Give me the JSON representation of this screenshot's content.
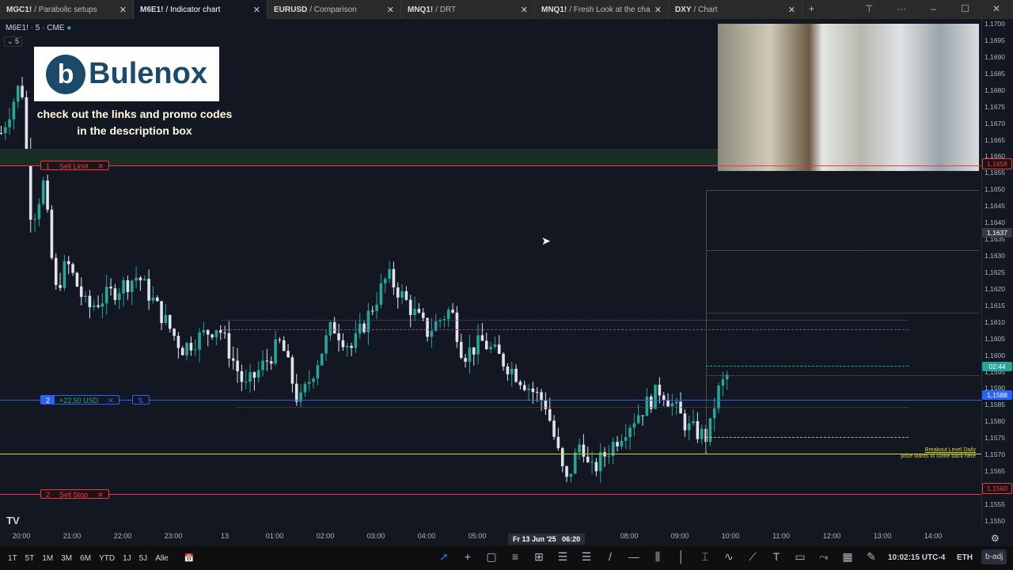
{
  "tabs": [
    {
      "symbol": "MGC1!",
      "name": "Parabolic setups",
      "active": false
    },
    {
      "symbol": "M6E1!",
      "name": "Indicator chart",
      "active": true
    },
    {
      "symbol": "EURUSD",
      "name": "Comparison",
      "active": false
    },
    {
      "symbol": "MNQ1!",
      "name": "DRT",
      "active": false
    },
    {
      "symbol": "MNQ1!",
      "name": "Fresh Look at the cha",
      "active": false
    },
    {
      "symbol": "DXY",
      "name": "Chart",
      "active": false
    }
  ],
  "legend": {
    "title": "M6E1! · 5 · CME",
    "collapse": "5"
  },
  "promo": {
    "brand": "Bulenox",
    "line1": "check out the links and promo codes",
    "line2": "in the description box"
  },
  "orders": {
    "sell_limit": {
      "qty": "1",
      "label": "Sell Limit",
      "close": "✕"
    },
    "position": {
      "qty": "2",
      "pnl": "+22,50 USD",
      "close": "✕",
      "reverse": "⇅"
    },
    "sell_stop": {
      "qty": "2",
      "label": "Sell Stop",
      "close": "✕"
    }
  },
  "annotation": {
    "line1": "Breakout Level Daily",
    "line2": "price wants to come back here"
  },
  "price_axis": {
    "ticks": [
      "1,1700",
      "1,1695",
      "1,1690",
      "1,1685",
      "1,1680",
      "1,1675",
      "1,1670",
      "1,1665",
      "1,1660",
      "1,1655",
      "1,1650",
      "1,1645",
      "1,1640",
      "1,1635",
      "1,1630",
      "1,1625",
      "1,1620",
      "1,1615",
      "1,1610",
      "1,1605",
      "1,1600",
      "1,1595",
      "1,1590",
      "1,1585",
      "1,1580",
      "1,1575",
      "1,1570",
      "1,1565",
      "1,1560",
      "1,1555",
      "1,1550"
    ],
    "labels": {
      "sell_limit": "1,1658",
      "crosshair": "1,1637",
      "countdown": "02:44",
      "position": "1,1588",
      "sell_stop": "1,1560"
    }
  },
  "time_axis": {
    "ticks": [
      "20:00",
      "21:00",
      "22:00",
      "23:00",
      "13",
      "01:00",
      "02:00",
      "03:00",
      "04:00",
      "05:00",
      "08:00",
      "09:00",
      "10:00",
      "11:00",
      "12:00",
      "13:00",
      "14:00"
    ],
    "crosshair": "Fr 13 Jun '25   06:20"
  },
  "ranges": [
    "1T",
    "5T",
    "1M",
    "3M",
    "6M",
    "YTD",
    "1J",
    "5J",
    "Alle"
  ],
  "status": {
    "clock": "10:02:15 UTC-4",
    "session": "ETH",
    "adj": "b-adj"
  },
  "colors": {
    "up": "#26a69a",
    "down": "#e0e3eb",
    "sell": "#f23645",
    "position": "#2962ff",
    "breakout": "#d4d43a"
  },
  "chart_data": {
    "type": "candlestick",
    "interval": "5",
    "ylim": [
      1.155,
      1.17
    ],
    "path_hours_since_2000": [
      [
        -0.4,
        1.1667
      ],
      [
        0,
        1.1683
      ],
      [
        0.2,
        1.164
      ],
      [
        0.44,
        1.1652
      ],
      [
        0.67,
        1.1619
      ],
      [
        0.9,
        1.1628
      ],
      [
        1.3,
        1.1614
      ],
      [
        2.3,
        1.1624
      ],
      [
        3.17,
        1.1602
      ],
      [
        3.88,
        1.1609
      ],
      [
        4.42,
        1.159
      ],
      [
        5.13,
        1.1604
      ],
      [
        5.48,
        1.1585
      ],
      [
        6.14,
        1.1609
      ],
      [
        6.53,
        1.1602
      ],
      [
        7.23,
        1.1624
      ],
      [
        8.02,
        1.1607
      ],
      [
        8.48,
        1.1614
      ],
      [
        8.72,
        1.16
      ],
      [
        9.11,
        1.1604
      ],
      [
        9.73,
        1.1595
      ],
      [
        10.36,
        1.1585
      ],
      [
        10.75,
        1.1561
      ],
      [
        11.06,
        1.1575
      ],
      [
        11.22,
        1.1564
      ],
      [
        11.92,
        1.1578
      ],
      [
        12.63,
        1.159
      ],
      [
        13.17,
        1.1578
      ],
      [
        13.56,
        1.1575
      ],
      [
        13.72,
        1.1588
      ],
      [
        13.98,
        1.1595
      ]
    ]
  }
}
